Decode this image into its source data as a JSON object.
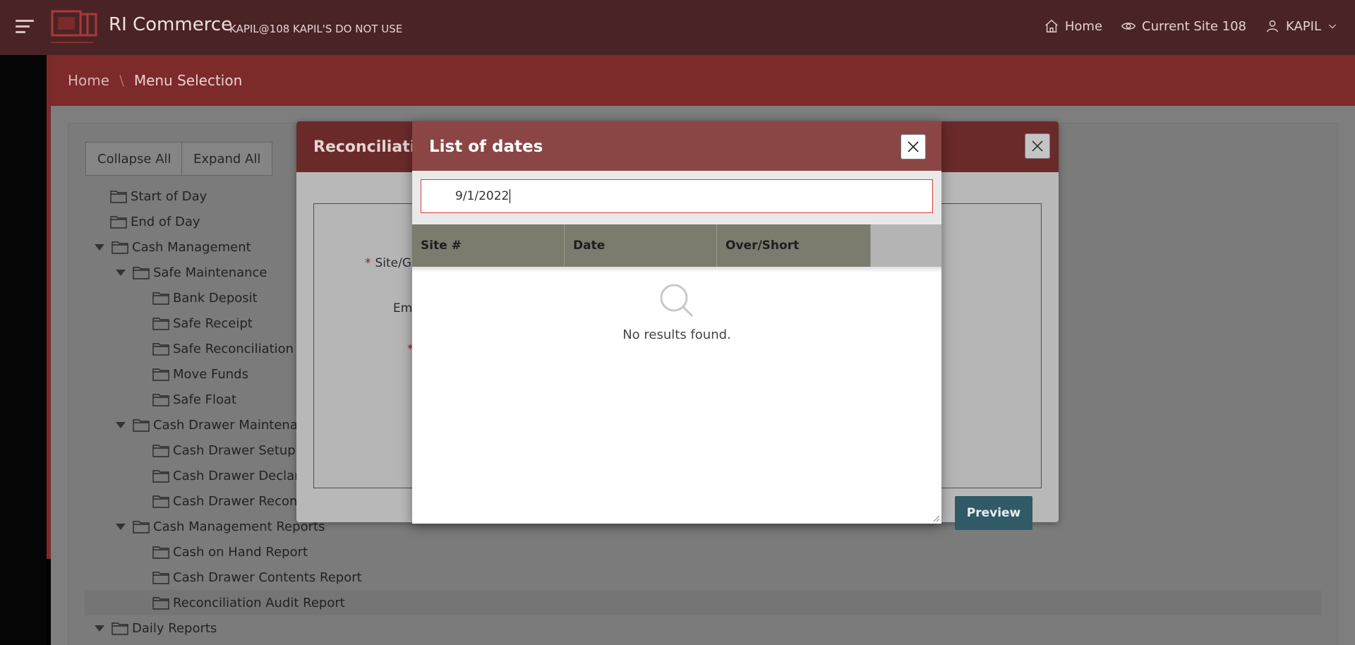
{
  "header": {
    "app_title": "RI Commerce",
    "app_subtitle": "KAPIL@108 KAPIL'S DO NOT USE",
    "nav": {
      "home": "Home",
      "current_site": "Current Site 108",
      "user": "KAPIL"
    }
  },
  "breadcrumb": {
    "home": "Home",
    "separator": "\\",
    "current": "Menu Selection"
  },
  "toolbar": {
    "collapse_all": "Collapse All",
    "expand_all": "Expand All"
  },
  "tree": [
    {
      "label": "Start of Day",
      "level": 0,
      "expanded": null
    },
    {
      "label": "End of Day",
      "level": 0,
      "expanded": null
    },
    {
      "label": "Cash Management",
      "level": 0,
      "expanded": true
    },
    {
      "label": "Safe Maintenance",
      "level": 1,
      "expanded": true
    },
    {
      "label": "Bank Deposit",
      "level": 2,
      "expanded": null
    },
    {
      "label": "Safe Receipt",
      "level": 2,
      "expanded": null
    },
    {
      "label": "Safe Reconciliation",
      "level": 2,
      "expanded": null
    },
    {
      "label": "Move Funds",
      "level": 2,
      "expanded": null
    },
    {
      "label": "Safe Float",
      "level": 2,
      "expanded": null
    },
    {
      "label": "Cash Drawer Maintenance",
      "level": 1,
      "expanded": true
    },
    {
      "label": "Cash Drawer Setup",
      "level": 2,
      "expanded": null
    },
    {
      "label": "Cash Drawer Declarati",
      "level": 2,
      "expanded": null
    },
    {
      "label": "Cash Drawer Reconcili",
      "level": 2,
      "expanded": null
    },
    {
      "label": "Cash Management Reports",
      "level": 1,
      "expanded": true
    },
    {
      "label": "Cash on Hand Report",
      "level": 2,
      "expanded": null
    },
    {
      "label": "Cash Drawer Contents Report",
      "level": 2,
      "expanded": null
    },
    {
      "label": "Reconciliation Audit Report",
      "level": 2,
      "expanded": null,
      "selected": true
    },
    {
      "label": "Daily Reports",
      "level": 0,
      "expanded": true
    }
  ],
  "reconciliation_modal": {
    "title": "Reconciliatio",
    "fields": {
      "site_label": "Site/Gr",
      "employee_label": "Emp",
      "required_mark": "*"
    },
    "preview_button": "Preview"
  },
  "dates_modal": {
    "title": "List of dates",
    "search_value": "9/1/2022",
    "columns": [
      "Site #",
      "Date",
      "Over/Short"
    ],
    "empty_message": "No results found."
  },
  "colors": {
    "header_bg": "#4a2325",
    "breadcrumb_bg": "#7d2a2a",
    "modal_header": "#8b4545",
    "preview_button": "#2f5a66"
  }
}
